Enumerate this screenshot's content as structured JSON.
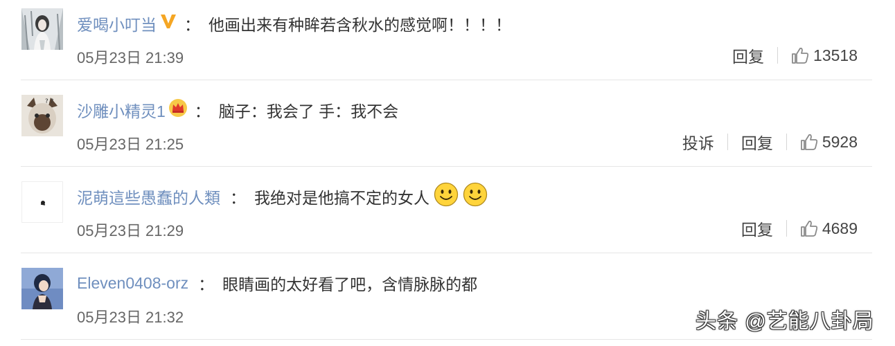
{
  "comments": [
    {
      "user": "爱喝小叮当",
      "colon": "：",
      "text": "他画出来有种眸若含秋水的感觉啊！！！！",
      "time": "05月23日 21:39",
      "actions": {
        "reply": "回复",
        "likes": "13518"
      },
      "badge": "v-badge-icon"
    },
    {
      "user": "沙雕小精灵1",
      "colon": "：",
      "text": "脑子：我会了 手：我不会",
      "time": "05月23日 21:25",
      "actions": {
        "report": "投诉",
        "reply": "回复",
        "likes": "5928"
      },
      "badge": "crown-badge-icon"
    },
    {
      "user": "泥萌這些愚蠢的人類",
      "colon": "：",
      "text": "我绝对是他搞不定的女人",
      "time": "05月23日 21:29",
      "actions": {
        "reply": "回复",
        "likes": "4689"
      },
      "emoji": [
        "smiley-icon",
        "smiley-icon"
      ]
    },
    {
      "user": "Eleven0408-orz",
      "colon": "：",
      "text": "眼睛画的太好看了吧，含情脉脉的都",
      "time": "05月23日 21:32"
    }
  ],
  "watermark": "头条 @艺能八卦局",
  "colors": {
    "username": "#6f8fbe",
    "text": "#333333",
    "time": "#666666",
    "divider": "#e6e6e6"
  }
}
